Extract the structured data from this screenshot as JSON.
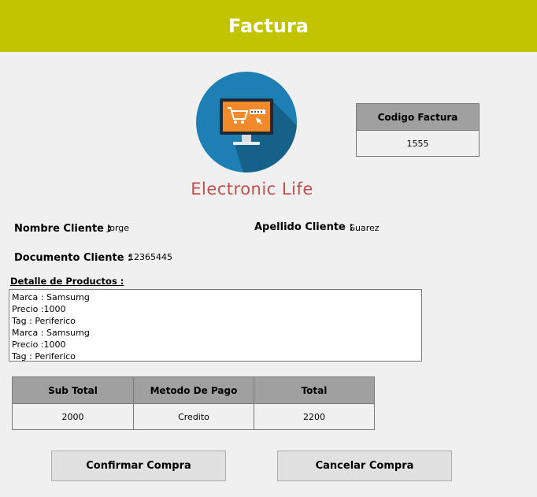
{
  "header": {
    "title": "Factura"
  },
  "brand": {
    "name": "Electronic Life",
    "logo_icon": "shopping-monitor-icon",
    "accent": "#c0504d"
  },
  "invoice_code": {
    "label": "Codigo Factura",
    "value": "1555"
  },
  "client": {
    "name_label": "Nombre Cliente :",
    "name_value": "Jorge",
    "surname_label": "Apellido Cliente :",
    "surname_value": "Suarez",
    "document_label": "Documento Cliente :",
    "document_value": "12365445"
  },
  "details": {
    "label": "Detalle de Productos :",
    "lines": [
      "Marca : Samsumg",
      "Precio :1000",
      "Tag : Periferico",
      "Marca : Samsumg",
      "Precio :1000",
      "Tag : Periferico"
    ]
  },
  "summary": {
    "headers": [
      "Sub Total",
      "Metodo De Pago",
      "Total"
    ],
    "values": [
      "2000",
      "Credito",
      "2200"
    ]
  },
  "buttons": {
    "confirm": "Confirmar Compra",
    "cancel": "Cancelar Compra"
  },
  "colors": {
    "header_bg": "#c2c400",
    "table_header_bg": "#a0a0a0",
    "logo_circle": "#1d7fb3"
  }
}
